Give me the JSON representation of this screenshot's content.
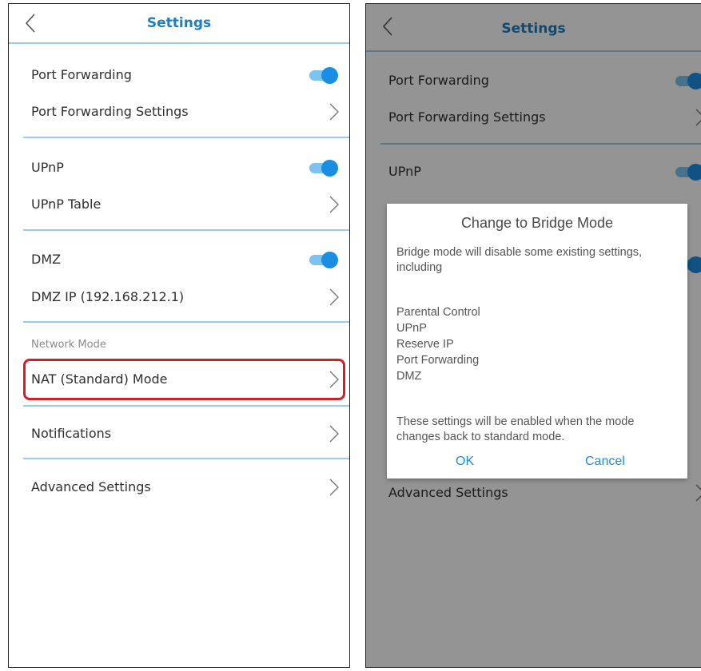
{
  "left": {
    "title": "Settings",
    "rows": [
      {
        "label": "Port Forwarding",
        "control": "toggle",
        "state": "on"
      },
      {
        "label": "Port Forwarding Settings",
        "control": "chevron"
      },
      {
        "label": "UPnP",
        "control": "toggle",
        "state": "on"
      },
      {
        "label": "UPnP Table",
        "control": "chevron"
      },
      {
        "label": "DMZ",
        "control": "toggle",
        "state": "on"
      },
      {
        "label": "DMZ IP (192.168.212.1)",
        "control": "chevron"
      },
      {
        "label": "NAT (Standard) Mode",
        "control": "chevron"
      },
      {
        "label": "Notifications",
        "control": "chevron"
      },
      {
        "label": "Advanced Settings",
        "control": "chevron"
      }
    ],
    "section_label": "Network Mode"
  },
  "right": {
    "title": "Settings",
    "rows": [
      {
        "label": "Port Forwarding"
      },
      {
        "label": "Port Forwarding Settings"
      },
      {
        "label": "UPnP"
      },
      {
        "label": "Advanced Settings"
      }
    ],
    "dialog": {
      "title": "Change to Bridge Mode",
      "intro": "Bridge mode will disable some existing settings, including",
      "items": [
        "Parental Control",
        "UPnP",
        "Reserve IP",
        "Port Forwarding",
        "DMZ"
      ],
      "outro": "These settings will be enabled when the mode changes back to standard mode.",
      "ok_label": "OK",
      "cancel_label": "Cancel"
    }
  },
  "colors": {
    "accent": "#1a7fc8",
    "toggle_on": "#1a8ee2",
    "divider": "#9ccbe8",
    "highlight": "#d0202b"
  },
  "icons": {
    "back": "chevron-left-icon",
    "row": "chevron-right-icon"
  }
}
